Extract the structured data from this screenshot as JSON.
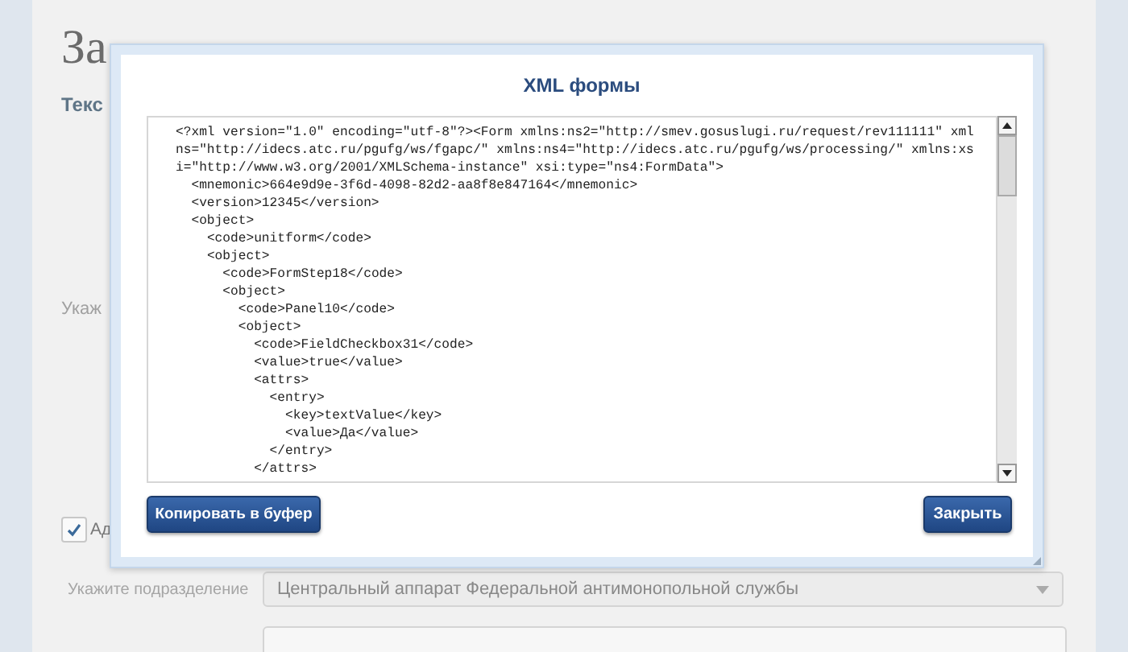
{
  "page": {
    "title": "За",
    "section_label": "Текс",
    "field_label": "Укаж",
    "checkbox": {
      "label": "Ад",
      "checked": true
    },
    "subdivision": {
      "label": "Укажите подразделение",
      "value": "Центральный аппарат Федеральной антимонопольной службы"
    }
  },
  "dialog": {
    "title": "XML формы",
    "xml_lines": [
      "<?xml version=\"1.0\" encoding=\"utf-8\"?><Form xmlns:ns2=\"http://smev.gosuslugi.ru/request/rev111111\" xmlns=\"http://idecs.atc.ru/pgufg/ws/fgapc/\" xmlns:ns4=\"http://idecs.atc.ru/pgufg/ws/processing/\" xmlns:xsi=\"http://www.w3.org/2001/XMLSchema-instance\" xsi:type=\"ns4:FormData\">",
      "  <mnemonic>664e9d9e-3f6d-4098-82d2-aa8f8e847164</mnemonic>",
      "  <version>12345</version>",
      "  <object>",
      "    <code>unitform</code>",
      "    <object>",
      "      <code>FormStep18</code>",
      "      <object>",
      "        <code>Panel10</code>",
      "        <object>",
      "          <code>FieldCheckbox31</code>",
      "          <value>true</value>",
      "          <attrs>",
      "            <entry>",
      "              <key>textValue</key>",
      "              <value>Да</value>",
      "            </entry>",
      "          </attrs>"
    ],
    "buttons": [
      {
        "label": "Копировать в буфер"
      },
      {
        "label": "Закрыть"
      }
    ]
  }
}
